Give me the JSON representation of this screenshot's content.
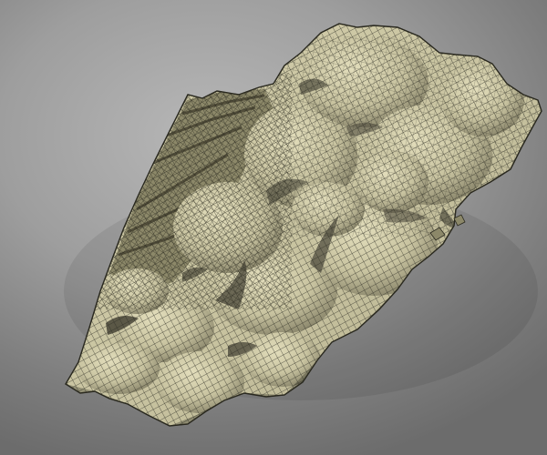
{
  "scene": {
    "type": "3D wireframe mesh render of a rocky terrain / rock formation",
    "background_color": "#9a9a9a",
    "mesh_surface_color": "#cfcaa8",
    "mesh_shadow_color": "#5f5c49",
    "wireframe_color": "#2c2b22"
  }
}
